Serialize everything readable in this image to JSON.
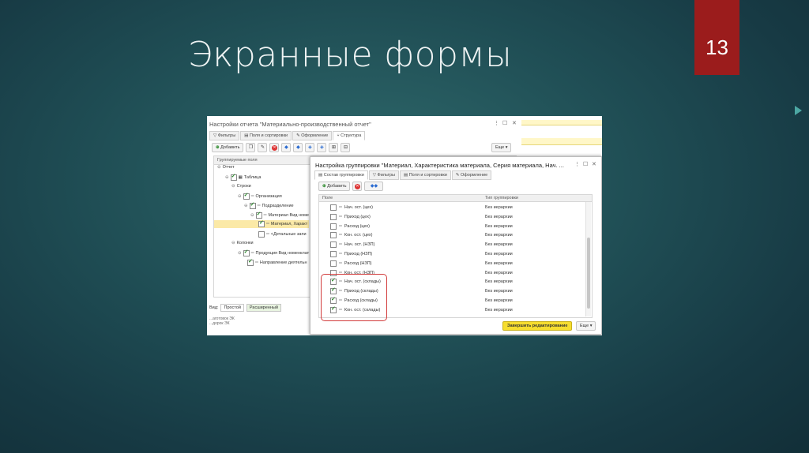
{
  "slide": {
    "title": "Экранные формы",
    "page_number": "13"
  },
  "back_window": {
    "title": "Настройки отчета \"Материально-производственный отчет\"",
    "controls": [
      "⋮",
      "☐",
      "✕"
    ],
    "tabs": [
      "Фильтры",
      "Поля и сортировки",
      "Оформление",
      "Структура"
    ],
    "add_label": "Добавить",
    "more_label": "Еще ▾",
    "tree_header": "Группируемые поля",
    "tree": [
      {
        "label": "Отчет",
        "checked": null
      },
      {
        "label": "Таблица",
        "checked": true
      },
      {
        "label": "Строки",
        "checked": null
      },
      {
        "label": "Организация",
        "checked": true
      },
      {
        "label": "Подразделение",
        "checked": true
      },
      {
        "label": "Материал Вид номе",
        "checked": true
      },
      {
        "label": "Материал, Характ",
        "checked": true
      },
      {
        "label": "<Детальные запи",
        "checked": false
      },
      {
        "label": "Колонки",
        "checked": null
      },
      {
        "label": "Продукция Вид номенклат",
        "checked": true
      },
      {
        "label": "Направление деятельн",
        "checked": true
      }
    ],
    "view_label": "Вид:",
    "view_simple": "Простой",
    "view_extended": "Расширенный",
    "footer_lines": [
      "...аготовок ЭК",
      "...дорок ЭК"
    ]
  },
  "dialog": {
    "title": "Настройка группировки \"Материал, Характеристика материала, Серия материала, Нач. ...",
    "controls": [
      "⋮",
      "☐",
      "✕"
    ],
    "tabs": [
      "Состав группировки",
      "Фильтры",
      "Поля и сортировки",
      "Оформление"
    ],
    "add_label": "Добавить",
    "col_field": "Поле",
    "col_type": "Тип группировки",
    "rows": [
      {
        "field": "Нач. ост. (цех)",
        "type": "Без иерархии",
        "checked": false
      },
      {
        "field": "Приход (цех)",
        "type": "Без иерархии",
        "checked": false
      },
      {
        "field": "Расход (цех)",
        "type": "Без иерархии",
        "checked": false
      },
      {
        "field": "Кон. ост. (цех)",
        "type": "Без иерархии",
        "checked": false
      },
      {
        "field": "Нач. ост. (НЗП)",
        "type": "Без иерархии",
        "checked": false
      },
      {
        "field": "Приход (НЗП)",
        "type": "Без иерархии",
        "checked": false
      },
      {
        "field": "Расход (НЗП)",
        "type": "Без иерархии",
        "checked": false
      },
      {
        "field": "Кон. ост. (НЗП)",
        "type": "Без иерархии",
        "checked": false
      },
      {
        "field": "Нач. ост. (склады)",
        "type": "Без иерархии",
        "checked": true
      },
      {
        "field": "Приход (склады)",
        "type": "Без иерархии",
        "checked": true
      },
      {
        "field": "Расход (склады)",
        "type": "Без иерархии",
        "checked": true
      },
      {
        "field": "Кон. ост. (склады)",
        "type": "Без иерархии",
        "checked": true
      }
    ],
    "finish_label": "Завершить редактирование",
    "more_label": "Еще ▾"
  }
}
